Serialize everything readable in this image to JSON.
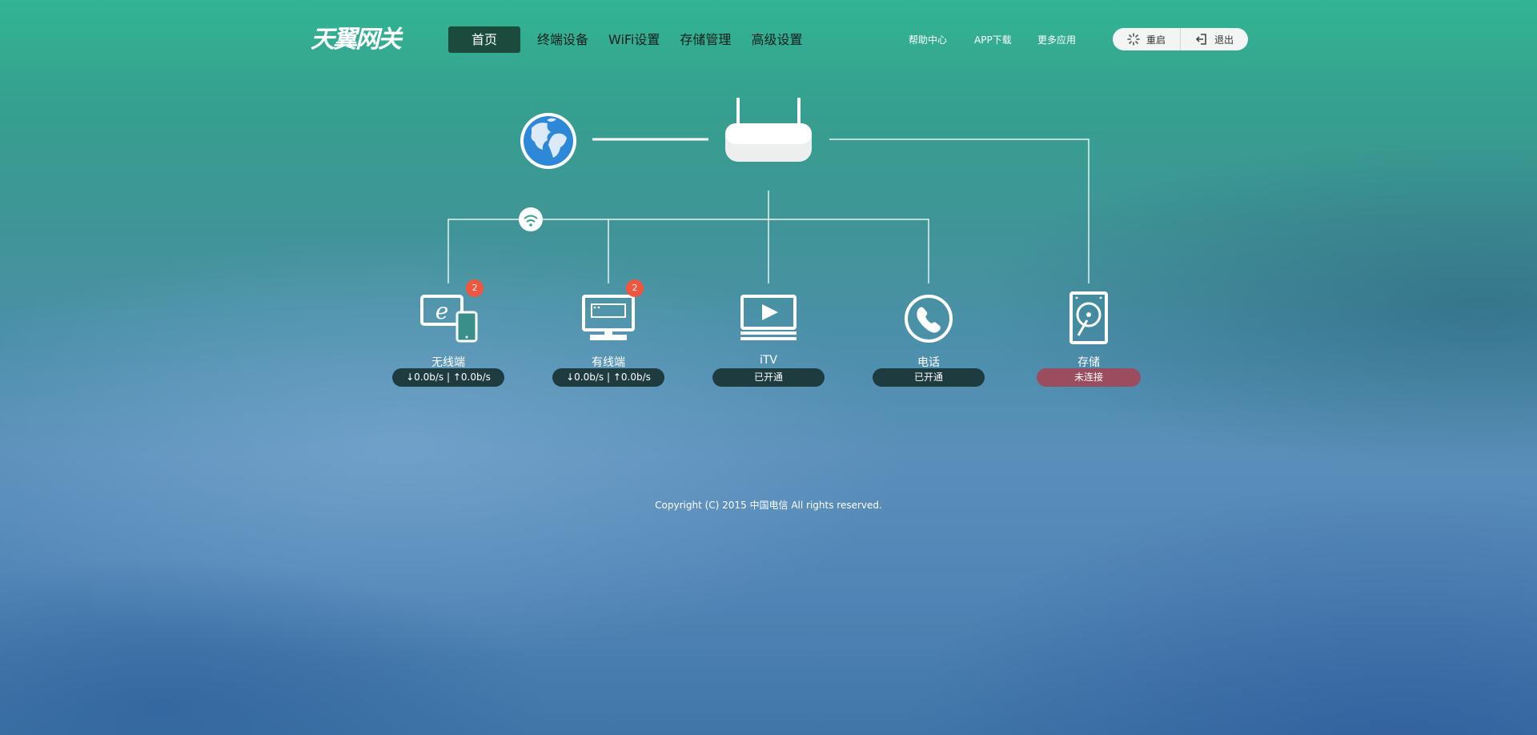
{
  "header": {
    "logo_text": "天翼网关",
    "nav": [
      "首页",
      "终端设备",
      "WiFi设置",
      "存储管理",
      "高级设置"
    ],
    "links": [
      "帮助中心",
      "APP下载",
      "更多应用"
    ],
    "restart_label": "重启",
    "logout_label": "退出"
  },
  "devices": [
    {
      "label": "无线端",
      "status": "↓0.0b/s | ↑0.0b/s",
      "badge": "2"
    },
    {
      "label": "有线端",
      "status": "↓0.0b/s | ↑0.0b/s",
      "badge": "2"
    },
    {
      "label": "iTV",
      "status": "已开通"
    },
    {
      "label": "电话",
      "status": "已开通"
    },
    {
      "label": "存储",
      "status": "未连接"
    }
  ],
  "footer": {
    "copyright": "Copyright (C) 2015 中国电信 All rights reserved."
  }
}
